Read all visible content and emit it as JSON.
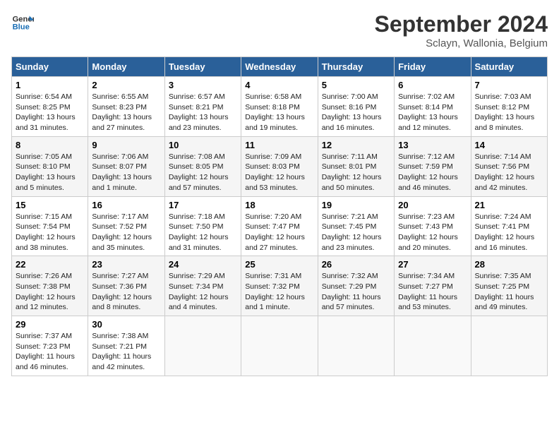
{
  "header": {
    "logo_line1": "General",
    "logo_line2": "Blue",
    "month": "September 2024",
    "location": "Sclayn, Wallonia, Belgium"
  },
  "days_of_week": [
    "Sunday",
    "Monday",
    "Tuesday",
    "Wednesday",
    "Thursday",
    "Friday",
    "Saturday"
  ],
  "weeks": [
    [
      {
        "day": "1",
        "info": "Sunrise: 6:54 AM\nSunset: 8:25 PM\nDaylight: 13 hours\nand 31 minutes."
      },
      {
        "day": "2",
        "info": "Sunrise: 6:55 AM\nSunset: 8:23 PM\nDaylight: 13 hours\nand 27 minutes."
      },
      {
        "day": "3",
        "info": "Sunrise: 6:57 AM\nSunset: 8:21 PM\nDaylight: 13 hours\nand 23 minutes."
      },
      {
        "day": "4",
        "info": "Sunrise: 6:58 AM\nSunset: 8:18 PM\nDaylight: 13 hours\nand 19 minutes."
      },
      {
        "day": "5",
        "info": "Sunrise: 7:00 AM\nSunset: 8:16 PM\nDaylight: 13 hours\nand 16 minutes."
      },
      {
        "day": "6",
        "info": "Sunrise: 7:02 AM\nSunset: 8:14 PM\nDaylight: 13 hours\nand 12 minutes."
      },
      {
        "day": "7",
        "info": "Sunrise: 7:03 AM\nSunset: 8:12 PM\nDaylight: 13 hours\nand 8 minutes."
      }
    ],
    [
      {
        "day": "8",
        "info": "Sunrise: 7:05 AM\nSunset: 8:10 PM\nDaylight: 13 hours\nand 5 minutes."
      },
      {
        "day": "9",
        "info": "Sunrise: 7:06 AM\nSunset: 8:07 PM\nDaylight: 13 hours\nand 1 minute."
      },
      {
        "day": "10",
        "info": "Sunrise: 7:08 AM\nSunset: 8:05 PM\nDaylight: 12 hours\nand 57 minutes."
      },
      {
        "day": "11",
        "info": "Sunrise: 7:09 AM\nSunset: 8:03 PM\nDaylight: 12 hours\nand 53 minutes."
      },
      {
        "day": "12",
        "info": "Sunrise: 7:11 AM\nSunset: 8:01 PM\nDaylight: 12 hours\nand 50 minutes."
      },
      {
        "day": "13",
        "info": "Sunrise: 7:12 AM\nSunset: 7:59 PM\nDaylight: 12 hours\nand 46 minutes."
      },
      {
        "day": "14",
        "info": "Sunrise: 7:14 AM\nSunset: 7:56 PM\nDaylight: 12 hours\nand 42 minutes."
      }
    ],
    [
      {
        "day": "15",
        "info": "Sunrise: 7:15 AM\nSunset: 7:54 PM\nDaylight: 12 hours\nand 38 minutes."
      },
      {
        "day": "16",
        "info": "Sunrise: 7:17 AM\nSunset: 7:52 PM\nDaylight: 12 hours\nand 35 minutes."
      },
      {
        "day": "17",
        "info": "Sunrise: 7:18 AM\nSunset: 7:50 PM\nDaylight: 12 hours\nand 31 minutes."
      },
      {
        "day": "18",
        "info": "Sunrise: 7:20 AM\nSunset: 7:47 PM\nDaylight: 12 hours\nand 27 minutes."
      },
      {
        "day": "19",
        "info": "Sunrise: 7:21 AM\nSunset: 7:45 PM\nDaylight: 12 hours\nand 23 minutes."
      },
      {
        "day": "20",
        "info": "Sunrise: 7:23 AM\nSunset: 7:43 PM\nDaylight: 12 hours\nand 20 minutes."
      },
      {
        "day": "21",
        "info": "Sunrise: 7:24 AM\nSunset: 7:41 PM\nDaylight: 12 hours\nand 16 minutes."
      }
    ],
    [
      {
        "day": "22",
        "info": "Sunrise: 7:26 AM\nSunset: 7:38 PM\nDaylight: 12 hours\nand 12 minutes."
      },
      {
        "day": "23",
        "info": "Sunrise: 7:27 AM\nSunset: 7:36 PM\nDaylight: 12 hours\nand 8 minutes."
      },
      {
        "day": "24",
        "info": "Sunrise: 7:29 AM\nSunset: 7:34 PM\nDaylight: 12 hours\nand 4 minutes."
      },
      {
        "day": "25",
        "info": "Sunrise: 7:31 AM\nSunset: 7:32 PM\nDaylight: 12 hours\nand 1 minute."
      },
      {
        "day": "26",
        "info": "Sunrise: 7:32 AM\nSunset: 7:29 PM\nDaylight: 11 hours\nand 57 minutes."
      },
      {
        "day": "27",
        "info": "Sunrise: 7:34 AM\nSunset: 7:27 PM\nDaylight: 11 hours\nand 53 minutes."
      },
      {
        "day": "28",
        "info": "Sunrise: 7:35 AM\nSunset: 7:25 PM\nDaylight: 11 hours\nand 49 minutes."
      }
    ],
    [
      {
        "day": "29",
        "info": "Sunrise: 7:37 AM\nSunset: 7:23 PM\nDaylight: 11 hours\nand 46 minutes."
      },
      {
        "day": "30",
        "info": "Sunrise: 7:38 AM\nSunset: 7:21 PM\nDaylight: 11 hours\nand 42 minutes."
      },
      {
        "day": "",
        "info": ""
      },
      {
        "day": "",
        "info": ""
      },
      {
        "day": "",
        "info": ""
      },
      {
        "day": "",
        "info": ""
      },
      {
        "day": "",
        "info": ""
      }
    ]
  ]
}
